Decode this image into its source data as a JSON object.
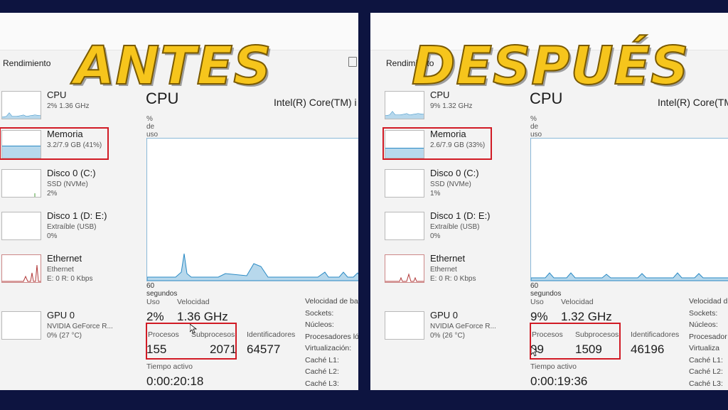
{
  "panels": [
    {
      "window_title": "Rendimiento",
      "overlay": "ANTES",
      "sidebar": [
        {
          "name": "CPU",
          "sub1": "2% 1.36 GHz",
          "sub2": ""
        },
        {
          "name": "Memoria",
          "sub1": "3.2/7.9 GB (41%)",
          "sub2": ""
        },
        {
          "name": "Disco 0 (C:)",
          "sub1": "SSD (NVMe)",
          "sub2": "2%"
        },
        {
          "name": "Disco 1 (D: E:)",
          "sub1": "Extraíble (USB)",
          "sub2": "0%"
        },
        {
          "name": "Ethernet",
          "sub1": "Ethernet",
          "sub2": "E: 0 R: 0 Kbps"
        },
        {
          "name": "GPU 0",
          "sub1": "NVIDIA GeForce R...",
          "sub2": "0% (27 °C)"
        }
      ],
      "main": {
        "title": "CPU",
        "model": "Intel(R) Core(TM) i",
        "usage_label": "% de uso",
        "seconds_label": "60 segundos",
        "uso_label": "Uso",
        "uso_value": "2%",
        "velocidad_label": "Velocidad",
        "velocidad_value": "1.36 GHz",
        "procesos_label": "Procesos",
        "procesos_value": "155",
        "subprocesos_label": "Subprocesos",
        "subprocesos_value": "2071",
        "identificadores_label": "Identificadores",
        "identificadores_value": "64577",
        "tiempo_label": "Tiempo activo",
        "tiempo_value": "0:00:20:18",
        "right_labels": [
          "Velocidad de ba",
          "Sockets:",
          "Núcleos:",
          "Procesadores ló",
          "Virtualización:",
          "Caché L1:",
          "Caché L2:",
          "Caché L3:"
        ]
      },
      "memory_level": 0.41
    },
    {
      "window_title": "Rendimiento",
      "overlay": "DESPUÉS",
      "sidebar": [
        {
          "name": "CPU",
          "sub1": "9% 1.32 GHz",
          "sub2": ""
        },
        {
          "name": "Memoria",
          "sub1": "2.6/7.9 GB (33%)",
          "sub2": ""
        },
        {
          "name": "Disco 0 (C:)",
          "sub1": "SSD (NVMe)",
          "sub2": "1%"
        },
        {
          "name": "Disco 1 (D: E:)",
          "sub1": "Extraíble (USB)",
          "sub2": "0%"
        },
        {
          "name": "Ethernet",
          "sub1": "Ethernet",
          "sub2": "E: 0 R: 0 Kbps"
        },
        {
          "name": "GPU 0",
          "sub1": "NVIDIA GeForce R...",
          "sub2": "0% (26 °C)"
        }
      ],
      "main": {
        "title": "CPU",
        "model": "Intel(R) Core(TM) i",
        "usage_label": "% de uso",
        "seconds_label": "60 segundos",
        "uso_label": "Uso",
        "uso_value": "9%",
        "velocidad_label": "Velocidad",
        "velocidad_value": "1.32 GHz",
        "procesos_label": "Procesos",
        "procesos_value": "99",
        "subprocesos_label": "Subprocesos",
        "subprocesos_value": "1509",
        "identificadores_label": "Identificadores",
        "identificadores_value": "46196",
        "tiempo_label": "Tiempo activo",
        "tiempo_value": "0:00:19:36",
        "right_labels": [
          "Velocidad d",
          "Sockets:",
          "Núcleos:",
          "Procesador",
          "Virtualiza",
          "Caché L1:",
          "Caché L2:",
          "Caché L3:"
        ]
      },
      "memory_level": 0.33
    }
  ],
  "colors": {
    "highlight": "#d11b25",
    "overlay_text": "#f6c51c",
    "graph_line": "#2a8ac4",
    "graph_fill": "#b7d8ec",
    "background": "#0d1440"
  },
  "icons": [
    "mouse-pointer-icon",
    "window-icon"
  ]
}
